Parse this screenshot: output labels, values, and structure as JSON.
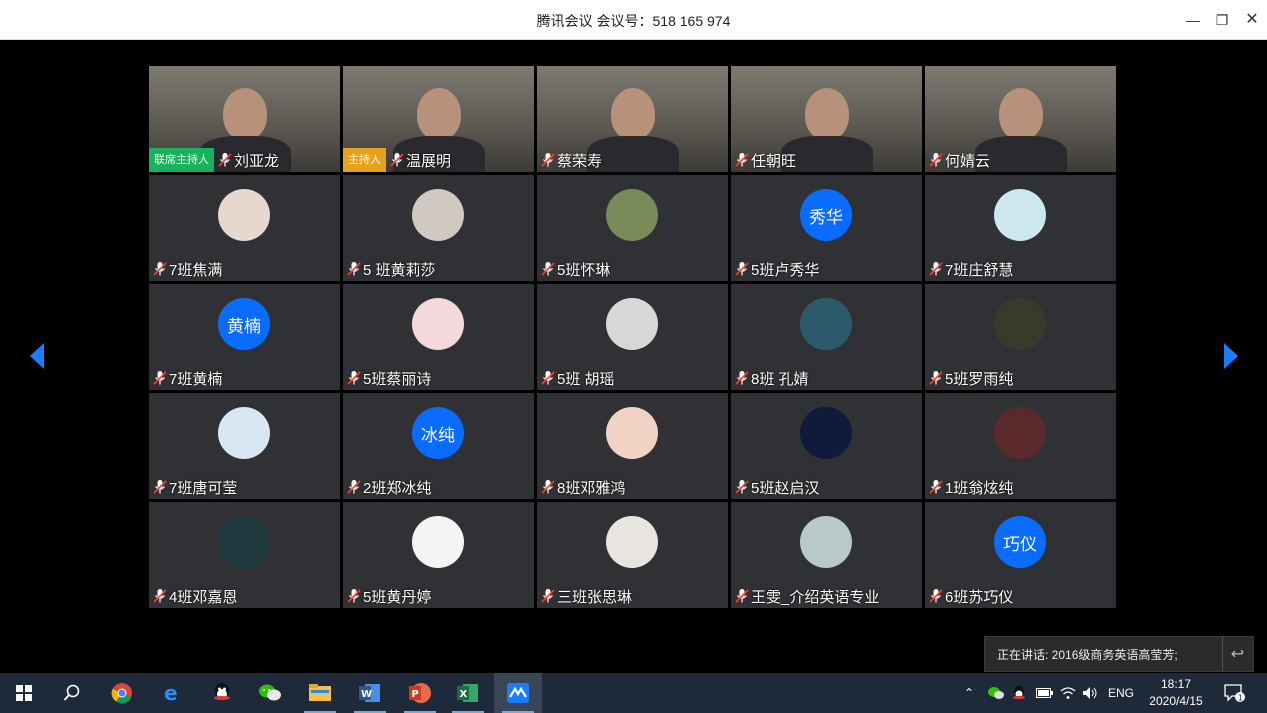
{
  "window": {
    "title": "腾讯会议 会议号：518 165 974"
  },
  "participants": [
    {
      "name": "刘亚龙",
      "type": "video",
      "badge": "联席主持人",
      "badge_type": "cohost"
    },
    {
      "name": "温展明",
      "type": "video",
      "badge": "主持人",
      "badge_type": "host"
    },
    {
      "name": "蔡荣寿",
      "type": "video"
    },
    {
      "name": "任朝旺",
      "type": "video"
    },
    {
      "name": "何婧云",
      "type": "video"
    },
    {
      "name": "7班焦满",
      "type": "avatar"
    },
    {
      "name": "5 班黄莉莎",
      "type": "avatar"
    },
    {
      "name": "5班怀琳",
      "type": "avatar"
    },
    {
      "name": "5班卢秀华",
      "type": "avatar",
      "avatar_text": "秀华"
    },
    {
      "name": "7班庄舒慧",
      "type": "avatar"
    },
    {
      "name": "7班黄楠",
      "type": "avatar",
      "avatar_text": "黄楠"
    },
    {
      "name": "5班蔡丽诗",
      "type": "avatar"
    },
    {
      "name": "5班 胡瑶",
      "type": "avatar"
    },
    {
      "name": "8班 孔婧",
      "type": "avatar"
    },
    {
      "name": " 5班罗雨纯",
      "type": "avatar"
    },
    {
      "name": "7班唐可莹",
      "type": "avatar"
    },
    {
      "name": "2班郑冰纯",
      "type": "avatar",
      "avatar_text": "冰纯"
    },
    {
      "name": "8班邓雅鸿",
      "type": "avatar"
    },
    {
      "name": "5班赵启汉",
      "type": "avatar"
    },
    {
      "name": "1班翁炫纯",
      "type": "avatar"
    },
    {
      "name": "4班邓嘉恩",
      "type": "avatar"
    },
    {
      "name": "5班黄丹婷",
      "type": "avatar"
    },
    {
      "name": "三班张思琳",
      "type": "avatar"
    },
    {
      "name": "王雯_介绍英语专业",
      "type": "avatar"
    },
    {
      "name": "6班苏巧仪",
      "type": "avatar",
      "avatar_text": "巧仪"
    }
  ],
  "speaking": {
    "text": "正在讲话: 2016级商务英语高莹芳;"
  },
  "taskbar": {
    "apps": [
      "windows-start",
      "search",
      "chrome",
      "edge",
      "qq",
      "wechat",
      "file-explorer",
      "word",
      "powerpoint",
      "excel",
      "tencent-meeting"
    ],
    "lang": "ENG",
    "time": "18:17",
    "date": "2020/4/15",
    "notification_count": "1"
  },
  "colors": {
    "accent": "#0a6cff",
    "host_badge": "#e8a21a",
    "cohost_badge": "#16b35a",
    "tile_bg": "#2f3134",
    "taskbar_bg": "#1e2a3a"
  }
}
